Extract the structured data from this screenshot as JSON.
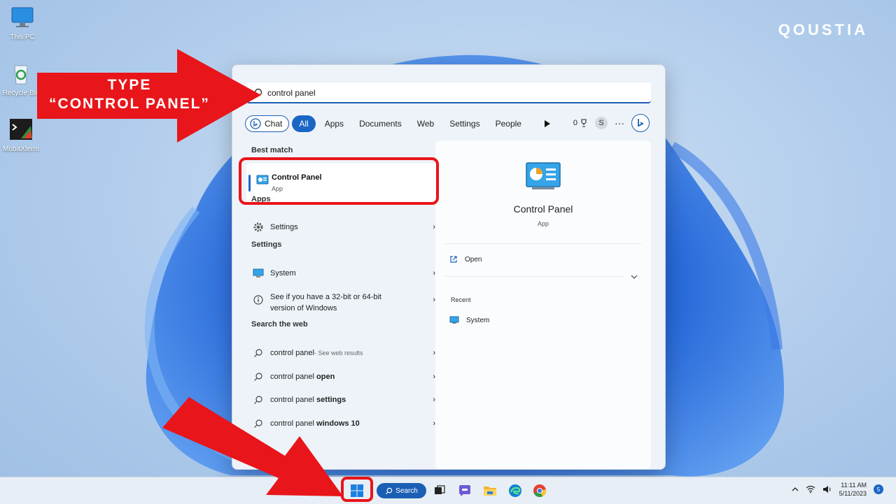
{
  "desktop": {
    "icons": [
      {
        "label": "This PC",
        "icon": "monitor-icon"
      },
      {
        "label": "Recycle Bin",
        "icon": "recycle-bin-icon"
      },
      {
        "label": "MobaXterm",
        "icon": "terminal-icon"
      }
    ]
  },
  "brand": "QOUSTIA",
  "annotation": {
    "line1": "TYPE",
    "line2": "“CONTROL PANEL”",
    "color": "#e8151a"
  },
  "search": {
    "query": "control panel",
    "filters": [
      "Chat",
      "All",
      "Apps",
      "Documents",
      "Web",
      "Settings",
      "People"
    ],
    "points": "0",
    "avatar": "S",
    "more": "···"
  },
  "results": {
    "best_match_heading": "Best match",
    "best": {
      "title": "Control Panel",
      "subtitle": "App"
    },
    "apps_heading": "Apps",
    "apps": [
      {
        "label": "Settings"
      }
    ],
    "settings_heading": "Settings",
    "settings": [
      {
        "label": "System"
      },
      {
        "label_line1": "See if you have a 32-bit or 64-bit",
        "label_line2": "version of Windows"
      }
    ],
    "web_heading": "Search the web",
    "web": [
      {
        "prefix": "control panel",
        "suffix": " - See web results"
      },
      {
        "prefix": "control panel ",
        "bold": "open"
      },
      {
        "prefix": "control panel ",
        "bold": "settings"
      },
      {
        "prefix": "control panel ",
        "bold": "windows 10"
      }
    ]
  },
  "preview": {
    "title": "Control Panel",
    "subtitle": "App",
    "open_label": "Open",
    "recent_heading": "Recent",
    "recent": [
      {
        "label": "System"
      }
    ]
  },
  "taskbar": {
    "search_label": "Search",
    "time": "11:11 AM",
    "date": "5/11/2023",
    "notifications": "5"
  },
  "colors": {
    "accent": "#1a66c4",
    "annotation_red": "#e8151a"
  }
}
